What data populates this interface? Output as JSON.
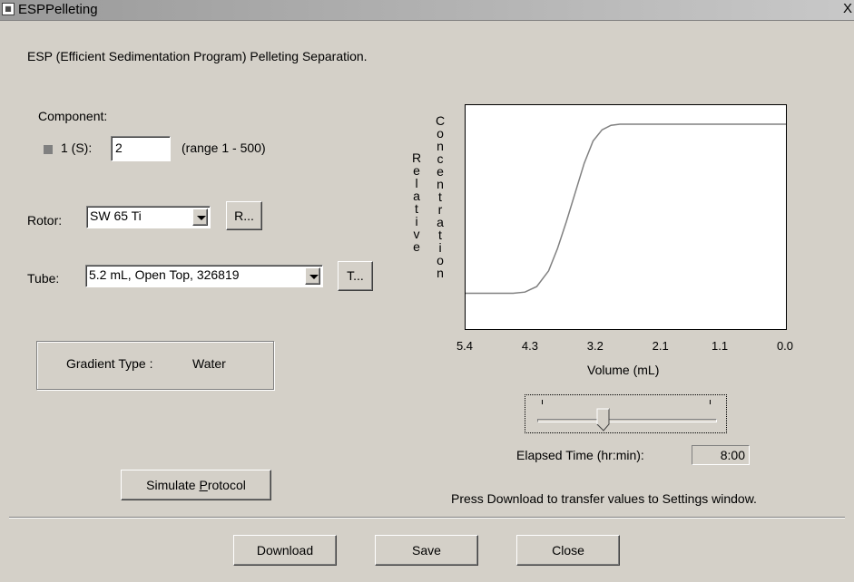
{
  "window": {
    "title": "ESPPelleting",
    "close_glyph": "X",
    "icon": "app-icon"
  },
  "description": "ESP (Efficient Sedimentation Program) Pelleting Separation.",
  "component": {
    "label": "Component:",
    "item_label": "1 (S):",
    "value": "2",
    "range": "(range 1 - 500)",
    "swatch_color": "#808080"
  },
  "rotor": {
    "label": "Rotor:",
    "selected": "SW 65 Ti",
    "button": "R..."
  },
  "tube": {
    "label": "Tube:",
    "selected": "5.2 mL, Open Top, 326819",
    "button": "T..."
  },
  "gradient": {
    "label": "Gradient Type :",
    "value": "Water"
  },
  "simulate_button": {
    "pre": "Simulate ",
    "accel": "P",
    "post": "rotocol"
  },
  "chart_data": {
    "type": "line",
    "ylabel": "Relative Concentration",
    "xlabel": "Volume (mL)",
    "x_ticks": [
      "5.4",
      "4.3",
      "3.2",
      "2.1",
      "1.1",
      "0.0"
    ],
    "xlim": [
      5.4,
      0.0
    ],
    "ylim": [
      0,
      1
    ],
    "series": [
      {
        "x": [
          5.4,
          4.6,
          4.4,
          4.2,
          4.0,
          3.85,
          3.7,
          3.55,
          3.4,
          3.25,
          3.1,
          2.95,
          2.8,
          2.6,
          2.2,
          1.5,
          0.0
        ],
        "y": [
          0.16,
          0.16,
          0.165,
          0.19,
          0.26,
          0.36,
          0.48,
          0.61,
          0.74,
          0.84,
          0.89,
          0.91,
          0.915,
          0.915,
          0.915,
          0.915,
          0.915
        ],
        "color": "#808080"
      }
    ]
  },
  "slider": {
    "value_fraction": 0.37
  },
  "elapsed": {
    "label": "Elapsed Time (hr:min):",
    "value": "8:00"
  },
  "hint": "Press Download to transfer values to Settings window.",
  "buttons": {
    "download": "Download",
    "save": "Save",
    "close": "Close"
  }
}
